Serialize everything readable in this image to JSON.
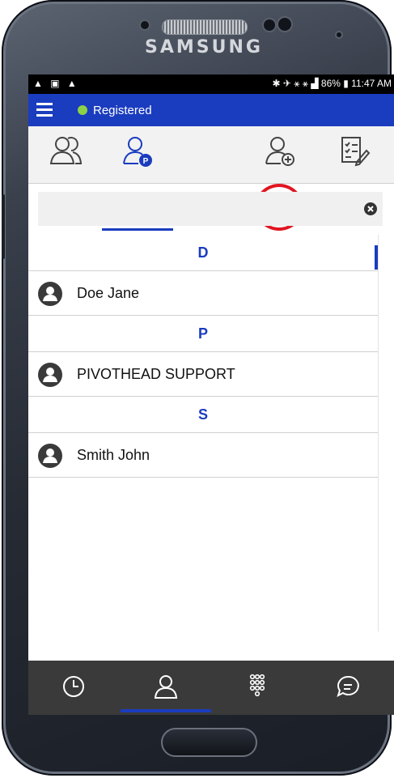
{
  "device": {
    "brand": "SAMSUNG"
  },
  "status_bar": {
    "left_icons": "▲ ▣ ▲",
    "right_text": "✱ ✈ ⚹ ⚹ ▟ 86% ▮ 11:47 AM"
  },
  "app_bar": {
    "menu_icon": "hamburger-menu-icon",
    "status_label": "Registered",
    "status_color": "#8cd147"
  },
  "tabs": [
    {
      "icon": "group-contacts-icon",
      "selected": false
    },
    {
      "icon": "personal-contacts-icon",
      "selected": true
    },
    {
      "icon": "add-contact-icon",
      "selected": false,
      "highlighted": true
    },
    {
      "icon": "edit-list-icon",
      "selected": false
    }
  ],
  "search": {
    "value": "",
    "clear_icon": "clear-search-icon"
  },
  "contacts": {
    "sections": [
      {
        "letter": "D",
        "items": [
          "Doe Jane"
        ]
      },
      {
        "letter": "P",
        "items": [
          "PIVOTHEAD SUPPORT"
        ]
      },
      {
        "letter": "S",
        "items": [
          "Smith John"
        ]
      }
    ]
  },
  "bottom_nav": [
    {
      "icon": "history-clock-icon",
      "selected": false
    },
    {
      "icon": "contacts-person-icon",
      "selected": true
    },
    {
      "icon": "dialpad-icon",
      "selected": false
    },
    {
      "icon": "chat-bubble-icon",
      "selected": false
    }
  ],
  "colors": {
    "accent": "#1a3cbf",
    "highlight": "#e01622"
  }
}
